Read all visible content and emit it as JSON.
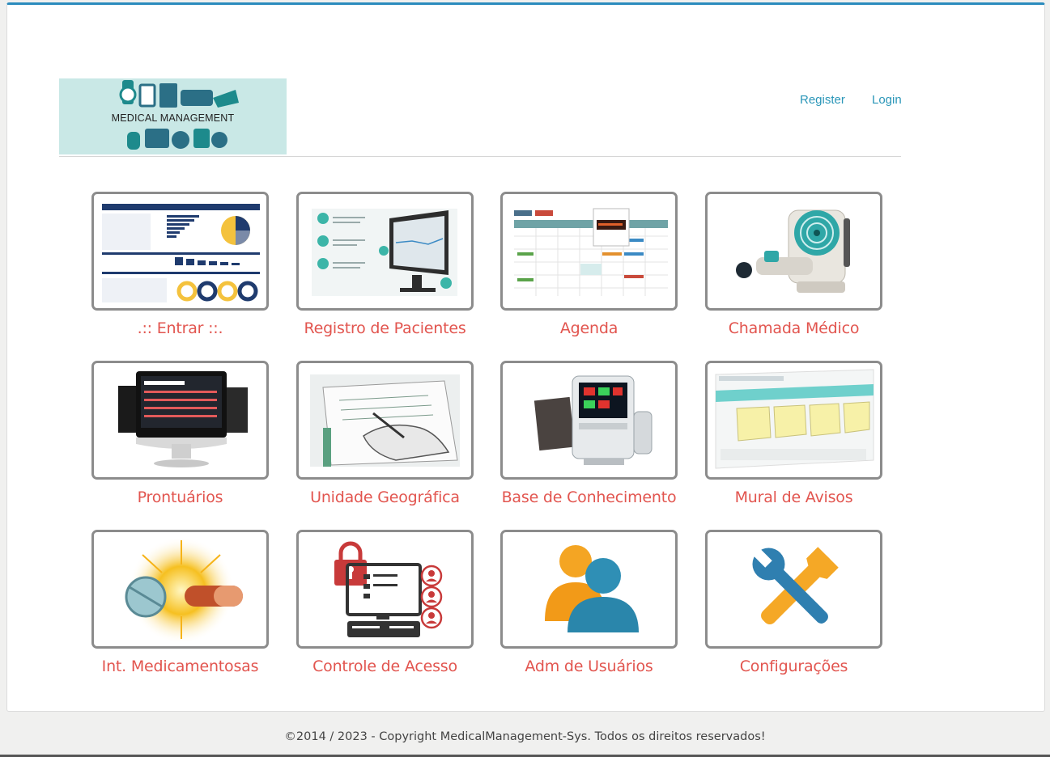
{
  "brand": {
    "logo_text": "MEDICAL MANAGEMENT"
  },
  "nav": {
    "register": "Register",
    "login": "Login"
  },
  "tiles": [
    {
      "label": ".:: Entrar ::.",
      "icon": "dashboard-icon"
    },
    {
      "label": "Registro de Pacientes",
      "icon": "patient-registry-icon"
    },
    {
      "label": "Agenda",
      "icon": "calendar-icon"
    },
    {
      "label": "Chamada Médico",
      "icon": "medical-device-icon"
    },
    {
      "label": "Prontuários",
      "icon": "monitor-records-icon"
    },
    {
      "label": "Unidade Geográfica",
      "icon": "hand-writing-icon"
    },
    {
      "label": "Base de Conhecimento",
      "icon": "patient-monitor-icon"
    },
    {
      "label": "Mural de Avisos",
      "icon": "sticky-notes-icon"
    },
    {
      "label": "Int. Medicamentosas",
      "icon": "pill-burst-icon"
    },
    {
      "label": "Controle de Acesso",
      "icon": "access-control-icon"
    },
    {
      "label": "Adm de Usuários",
      "icon": "users-icon"
    },
    {
      "label": "Configurações",
      "icon": "tools-icon"
    }
  ],
  "footer": {
    "text": "©2014 / 2023 - Copyright MedicalManagement-Sys. Todos os direitos reservados!"
  },
  "colors": {
    "accent": "#2a8bbd",
    "link": "#2a96b8",
    "caption": "#e2554f"
  }
}
